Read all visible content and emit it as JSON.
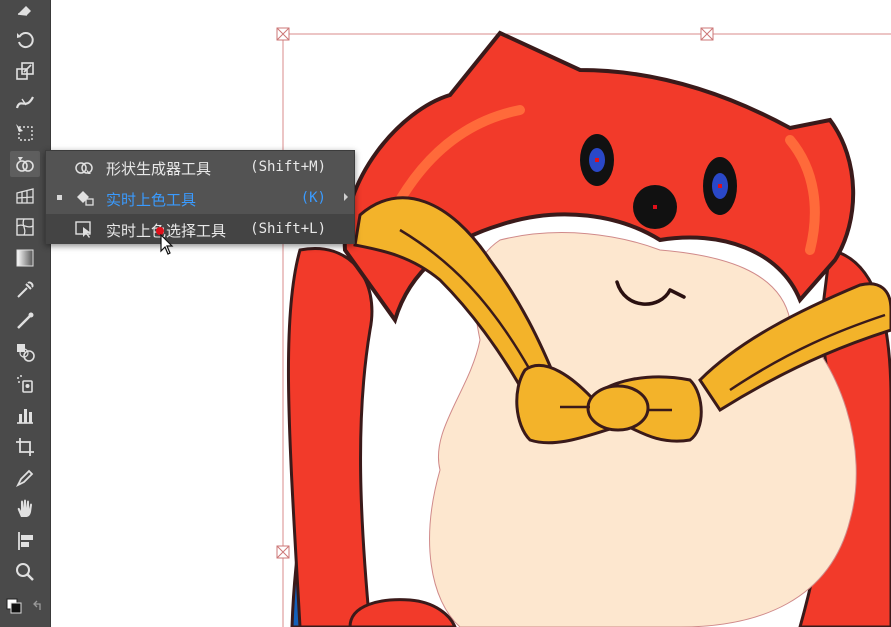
{
  "toolbar": {
    "tools": [
      {
        "name": "eraser-icon"
      },
      {
        "name": "rotate-icon"
      },
      {
        "name": "scale-icon"
      },
      {
        "name": "width-icon"
      },
      {
        "name": "free-transform-icon"
      },
      {
        "name": "shape-builder-icon",
        "active": true
      },
      {
        "name": "perspective-grid-icon"
      },
      {
        "name": "mesh-icon"
      },
      {
        "name": "gradient-icon"
      },
      {
        "name": "eyedropper-icon"
      },
      {
        "name": "measure-icon"
      },
      {
        "name": "blend-icon"
      },
      {
        "name": "symbol-sprayer-icon"
      },
      {
        "name": "column-graph-icon"
      },
      {
        "name": "artboard-icon"
      },
      {
        "name": "slice-icon"
      },
      {
        "name": "hand-icon"
      },
      {
        "name": "print-tiling-icon"
      },
      {
        "name": "zoom-icon"
      },
      {
        "name": "fill-stroke-icon"
      }
    ]
  },
  "flyout": {
    "items": [
      {
        "label": "形状生成器工具",
        "shortcut": "(Shift+M)",
        "icon": "shape-builder-icon",
        "selected": false
      },
      {
        "label": "实时上色工具",
        "shortcut": "(K)",
        "icon": "live-paint-bucket-icon",
        "selected": true
      },
      {
        "label": "实时上色选择工具",
        "shortcut": "(Shift+L)",
        "icon": "live-paint-selection-icon",
        "selected": false,
        "hovered": true
      }
    ]
  },
  "colors": {
    "toolbar_bg": "#4a4a4a",
    "flyout_bg": "#535353",
    "selected_text": "#3a9bff",
    "fox_red": "#f23a2a",
    "fox_cream": "#fde7cf",
    "scarf_yellow": "#f3b32a",
    "cape_blue": "#1560b8"
  }
}
